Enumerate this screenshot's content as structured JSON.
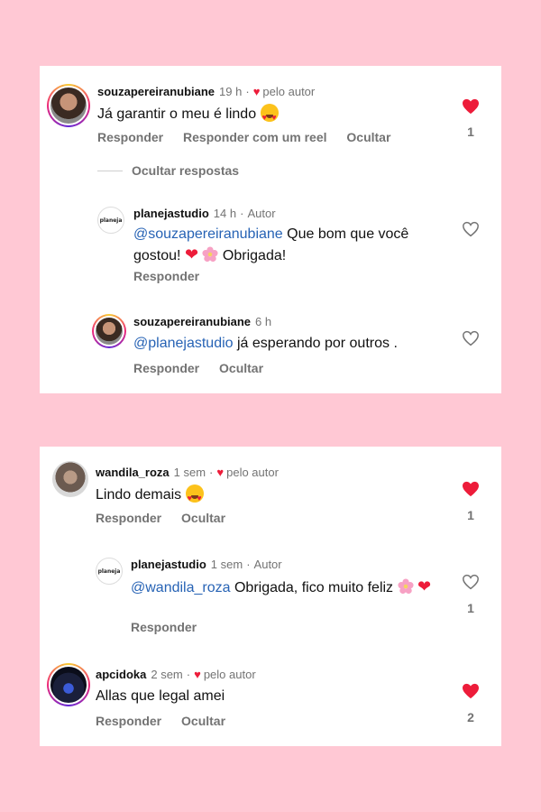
{
  "colors": {
    "background": "#ffc8d4",
    "like_red": "#ed1c3a",
    "mention_blue": "#2763b5",
    "muted": "#737373"
  },
  "card1": {
    "comment": {
      "username": "souzapereiranubiane",
      "time": "19 h",
      "liked_by_author": "pelo autor",
      "text": "Já garantir o meu é lindo",
      "emoji": "heart-eyes-emoji",
      "actions": [
        "Responder",
        "Responder com um reel",
        "Ocultar"
      ],
      "like_count": "1",
      "liked": true
    },
    "hide_replies": "Ocultar respostas",
    "replies": [
      {
        "username": "planejastudio",
        "time": "14 h",
        "badge": "Autor",
        "avatar_text": "planeja",
        "mention": "@souzapereiranubiane",
        "text": " Que bom que você gostou! ",
        "text_end": " Obrigada!",
        "actions": [
          "Responder"
        ]
      },
      {
        "username": "souzapereiranubiane",
        "time": "6 h",
        "mention": "@planejastudio",
        "text": " já esperando por outros .",
        "actions": [
          "Responder",
          "Ocultar"
        ]
      }
    ]
  },
  "card2": {
    "comment": {
      "username": "wandila_roza",
      "time": "1 sem",
      "liked_by_author": "pelo autor",
      "text": "Lindo demais",
      "actions": [
        "Responder",
        "Ocultar"
      ],
      "like_count": "1",
      "liked": true
    },
    "reply": {
      "username": "planejastudio",
      "time": "1 sem",
      "badge": "Autor",
      "avatar_text": "planeja",
      "mention": "@wandila_roza",
      "text": " Obrigada, fico muito feliz ",
      "actions": [
        "Responder"
      ],
      "like_count": "1"
    },
    "comment2": {
      "username": "apcidoka",
      "time": "2 sem",
      "liked_by_author": "pelo autor",
      "text": "Allas que legal amei",
      "actions": [
        "Responder",
        "Ocultar"
      ],
      "like_count": "2",
      "liked": true
    }
  }
}
